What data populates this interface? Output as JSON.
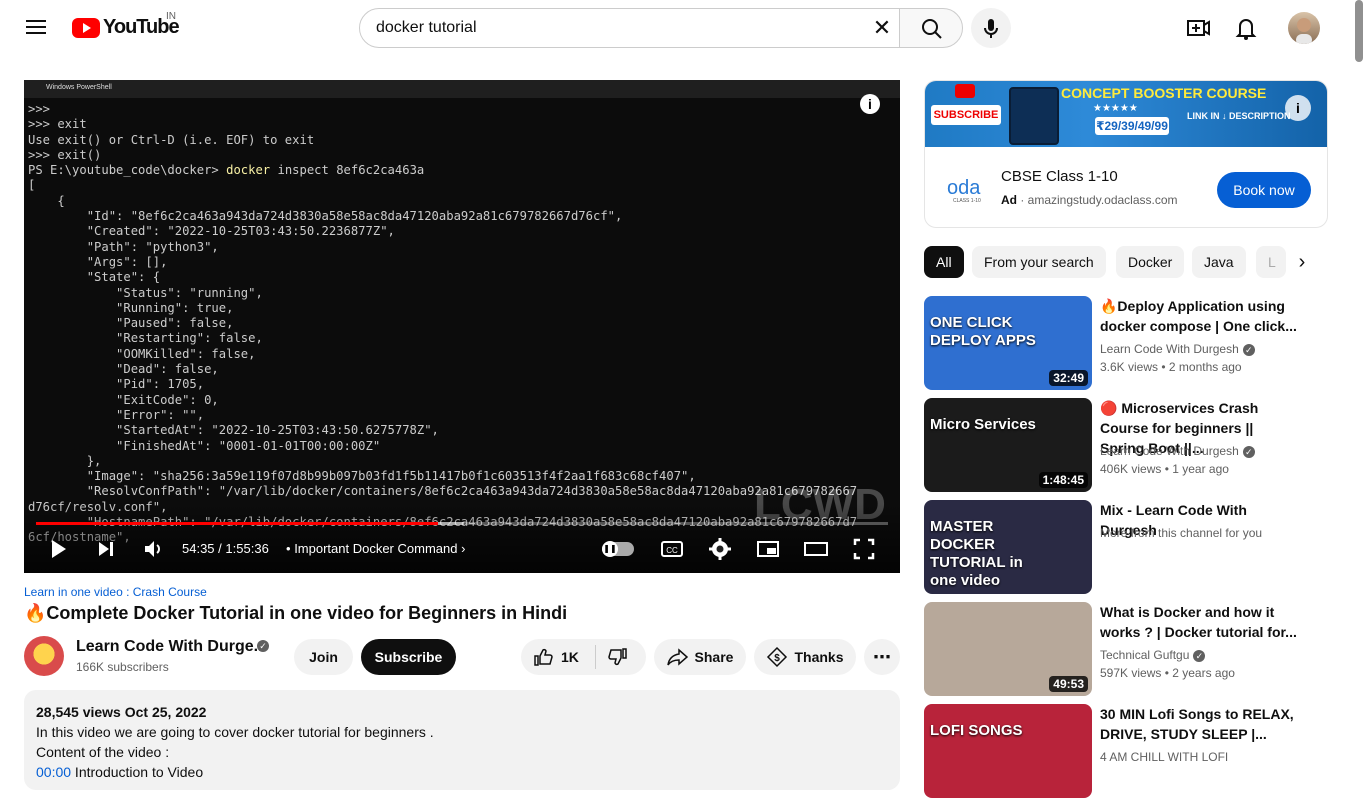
{
  "header": {
    "logo_text": "YouTube",
    "country_code": "IN",
    "search_value": "docker tutorial"
  },
  "player": {
    "terminal_tab": "Windows PowerShell",
    "terminal_lines": [
      ">>>",
      ">>> exit",
      "Use exit() or Ctrl-D (i.e. EOF) to exit",
      ">>> exit()",
      "PS E:\\youtube_code\\docker> docker inspect 8ef6c2ca463a",
      "[",
      "    {",
      "        \"Id\": \"8ef6c2ca463a943da724d3830a58e58ac8da47120aba92a81c679782667d76cf\",",
      "        \"Created\": \"2022-10-25T03:43:50.2236877Z\",",
      "        \"Path\": \"python3\",",
      "        \"Args\": [],",
      "        \"State\": {",
      "            \"Status\": \"running\",",
      "            \"Running\": true,",
      "            \"Paused\": false,",
      "            \"Restarting\": false,",
      "            \"OOMKilled\": false,",
      "            \"Dead\": false,",
      "            \"Pid\": 1705,",
      "            \"ExitCode\": 0,",
      "            \"Error\": \"\",",
      "            \"StartedAt\": \"2022-10-25T03:43:50.6275778Z\",",
      "            \"FinishedAt\": \"0001-01-01T00:00:00Z\"",
      "        },",
      "        \"Image\": \"sha256:3a59e119f07d8b99b097b03fd1f5b11417b0f1c603513f4f2aa1f683c68cf407\",",
      "        \"ResolvConfPath\": \"/var/lib/docker/containers/8ef6c2ca463a943da724d3830a58e58ac8da47120aba92a81c679782667",
      "d76cf/resolv.conf\",",
      "        \"HostnamePath\": \"/var/lib/docker/containers/8ef6c2ca463a943da724d3830a58e58ac8da47120aba92a81c679782667d7",
      "6cf/hostname\","
    ],
    "watermark": "LCWD",
    "info_glyph": "i",
    "time_current": "54:35",
    "time_total": "1:55:36",
    "time_separator": "/",
    "chapter": "Important Docker Command",
    "progress_fraction": 0.472
  },
  "video": {
    "hashtag_line": "Learn in one video : Crash Course",
    "title": "🔥Complete Docker Tutorial in one video for Beginners in Hindi",
    "channel_name": "Learn Code With Durge...",
    "subscribers": "166K subscribers",
    "join_label": "Join",
    "subscribe_label": "Subscribe",
    "likes": "1K",
    "share_label": "Share",
    "thanks_label": "Thanks",
    "more_glyph": "⋯",
    "views_date": "28,545 views  Oct 25, 2022",
    "desc_line1": "In this video we are going to cover docker tutorial for beginners .",
    "desc_line2": "Content of the video :",
    "desc_line3_time": "00:00",
    "desc_line3_text": " Introduction to Video"
  },
  "ad": {
    "subscribe_badge": "SUBSCRIBE",
    "concept_text": "CONCEPT BOOSTER COURSE",
    "price": "₹29/39/49/99",
    "link_text": "LINK IN ↓ DESCRIPTION",
    "logo": "oda",
    "logo_sub": "CLASS 1-10",
    "title": "CBSE Class 1-10",
    "ad_label": "Ad",
    "domain": "amazingstudy.odaclass.com",
    "cta": "Book now"
  },
  "chips": [
    {
      "label": "All"
    },
    {
      "label": "From your search"
    },
    {
      "label": "Docker"
    },
    {
      "label": "Java"
    },
    {
      "label": "L"
    }
  ],
  "recommendations": [
    {
      "title": "🔥Deploy Application using docker compose | One click...",
      "channel": "Learn Code With Durgesh",
      "meta": "3.6K views  •  2 months ago",
      "duration": "32:49",
      "thumb_caption": "ONE CLICK DEPLOY APPS",
      "thumb_color": "#2f6fd0",
      "verified": true
    },
    {
      "title": "🔴 Microservices Crash Course for beginners || Spring Boot ||...",
      "channel": "Learn Code With Durgesh",
      "meta": "406K views  •  1 year ago",
      "duration": "1:48:45",
      "thumb_caption": "Micro Services",
      "thumb_color": "#1b1b1b",
      "verified": true
    },
    {
      "title": "Mix - Learn Code With Durgesh",
      "channel": "More from this channel for you",
      "meta": "",
      "duration": "",
      "thumb_caption": "MASTER DOCKER TUTORIAL in one video",
      "thumb_color": "#2a2a44",
      "verified": false
    },
    {
      "title": "What is Docker and how it works ? | Docker tutorial for...",
      "channel": "Technical Guftgu",
      "meta": "597K views  •  2 years ago",
      "duration": "49:53",
      "thumb_caption": "",
      "thumb_color": "#b7a89a",
      "verified": true
    },
    {
      "title": "30 MIN Lofi Songs to RELAX, DRIVE, STUDY SLEEP |...",
      "channel": "4 AM CHILL WITH LOFI",
      "meta": "",
      "duration": "",
      "thumb_caption": "LOFI SONGS",
      "thumb_color": "#b8233a",
      "verified": false
    }
  ]
}
